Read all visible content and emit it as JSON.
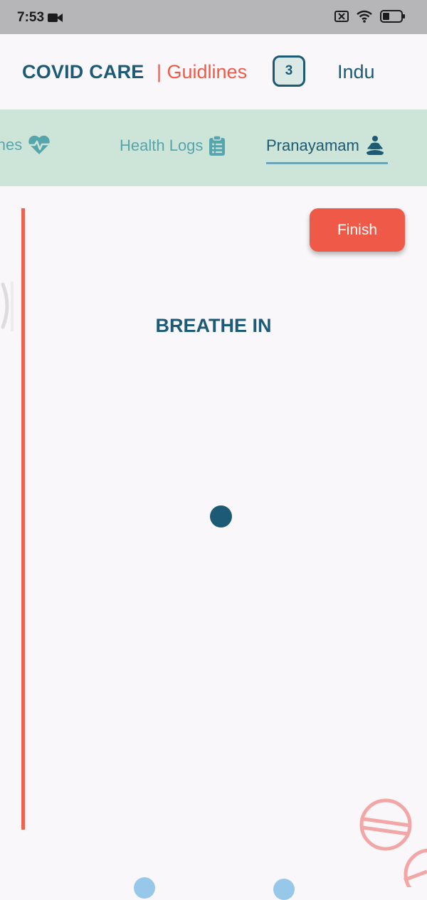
{
  "status_bar": {
    "time": "7:53",
    "icons": [
      "video-camera-icon",
      "no-sim-icon",
      "wifi-icon",
      "battery-icon"
    ]
  },
  "header": {
    "brand": "COVID CARE",
    "section": "| Guidlines",
    "badge_count": "3",
    "user_name": "Indu"
  },
  "tabs": [
    {
      "label": "lines",
      "icon": "heart-pulse-icon",
      "active": false
    },
    {
      "label": "Health Logs",
      "icon": "clipboard-list-icon",
      "active": false
    },
    {
      "label": "Pranayamam",
      "icon": "meditation-icon",
      "active": true
    }
  ],
  "exercise": {
    "finish_label": "Finish",
    "instruction": "BREATHE IN"
  },
  "colors": {
    "primary": "#1c5a75",
    "accent": "#ef5a48",
    "tab_bar_bg": "#cde5d9",
    "tab_inactive": "#56a5ad",
    "background": "#f9f7fa"
  }
}
